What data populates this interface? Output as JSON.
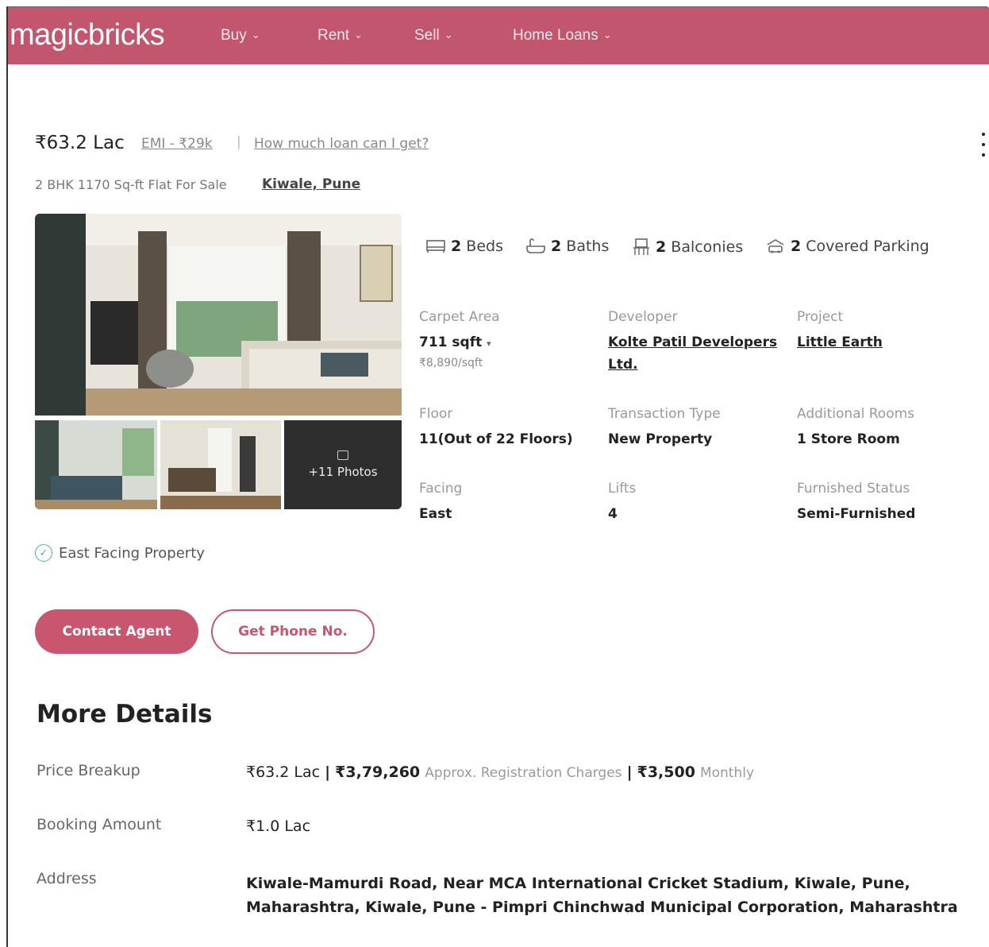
{
  "header": {
    "logo": "magicbricks",
    "nav": [
      {
        "label": "Buy"
      },
      {
        "label": "Rent"
      },
      {
        "label": "Sell"
      },
      {
        "label": "Home Loans"
      }
    ]
  },
  "listing": {
    "price": "₹63.2 Lac",
    "emi": "EMI - ₹29k",
    "separator": "|",
    "loan_link": "How much loan can I get?",
    "subtitle": "2 BHK 1170 Sq-ft Flat For Sale",
    "locality": "Kiwale, Pune",
    "photos_label": "+11 Photos"
  },
  "amenities": [
    {
      "icon": "bed-icon",
      "count": "2",
      "label": "Beds"
    },
    {
      "icon": "bath-icon",
      "count": "2",
      "label": "Baths"
    },
    {
      "icon": "balcony-icon",
      "count": "2",
      "label": "Balconies"
    },
    {
      "icon": "parking-icon",
      "count": "2",
      "label": "Covered Parking"
    }
  ],
  "details": {
    "carpet_area": {
      "label": "Carpet Area",
      "value": "711 sqft",
      "sub": "₹8,890/sqft"
    },
    "developer": {
      "label": "Developer",
      "value_line1": "Kolte Patil Developers",
      "value_line2": "Ltd."
    },
    "project": {
      "label": "Project",
      "value": "Little Earth"
    },
    "floor": {
      "label": "Floor",
      "value": "11(Out of 22 Floors)"
    },
    "transaction": {
      "label": "Transaction Type",
      "value": "New Property"
    },
    "additional_rooms": {
      "label": "Additional Rooms",
      "value": "1 Store Room"
    },
    "facing": {
      "label": "Facing",
      "value": "East"
    },
    "lifts": {
      "label": "Lifts",
      "value": "4"
    },
    "furnished": {
      "label": "Furnished Status",
      "value": "Semi-Furnished"
    }
  },
  "highlight": "East Facing Property",
  "buttons": {
    "contact": "Contact Agent",
    "phone": "Get Phone No."
  },
  "more": {
    "title": "More Details",
    "price_breakup": {
      "label": "Price Breakup",
      "price": "₹63.2 Lac",
      "reg": "₹3,79,260",
      "reg_text": "Approx. Registration Charges",
      "maint": "₹3,500",
      "maint_text": "Monthly",
      "sep": "|"
    },
    "booking": {
      "label": "Booking Amount",
      "value": "₹1.0 Lac"
    },
    "address": {
      "label": "Address",
      "value": "Kiwale-Mamurdi Road, Near MCA International Cricket Stadium, Kiwale, Pune, Maharashtra, Kiwale, Pune - Pimpri Chinchwad Municipal Corporation, Maharashtra"
    }
  },
  "colors": {
    "brand": "#c2566f",
    "check": "#4db38a"
  }
}
